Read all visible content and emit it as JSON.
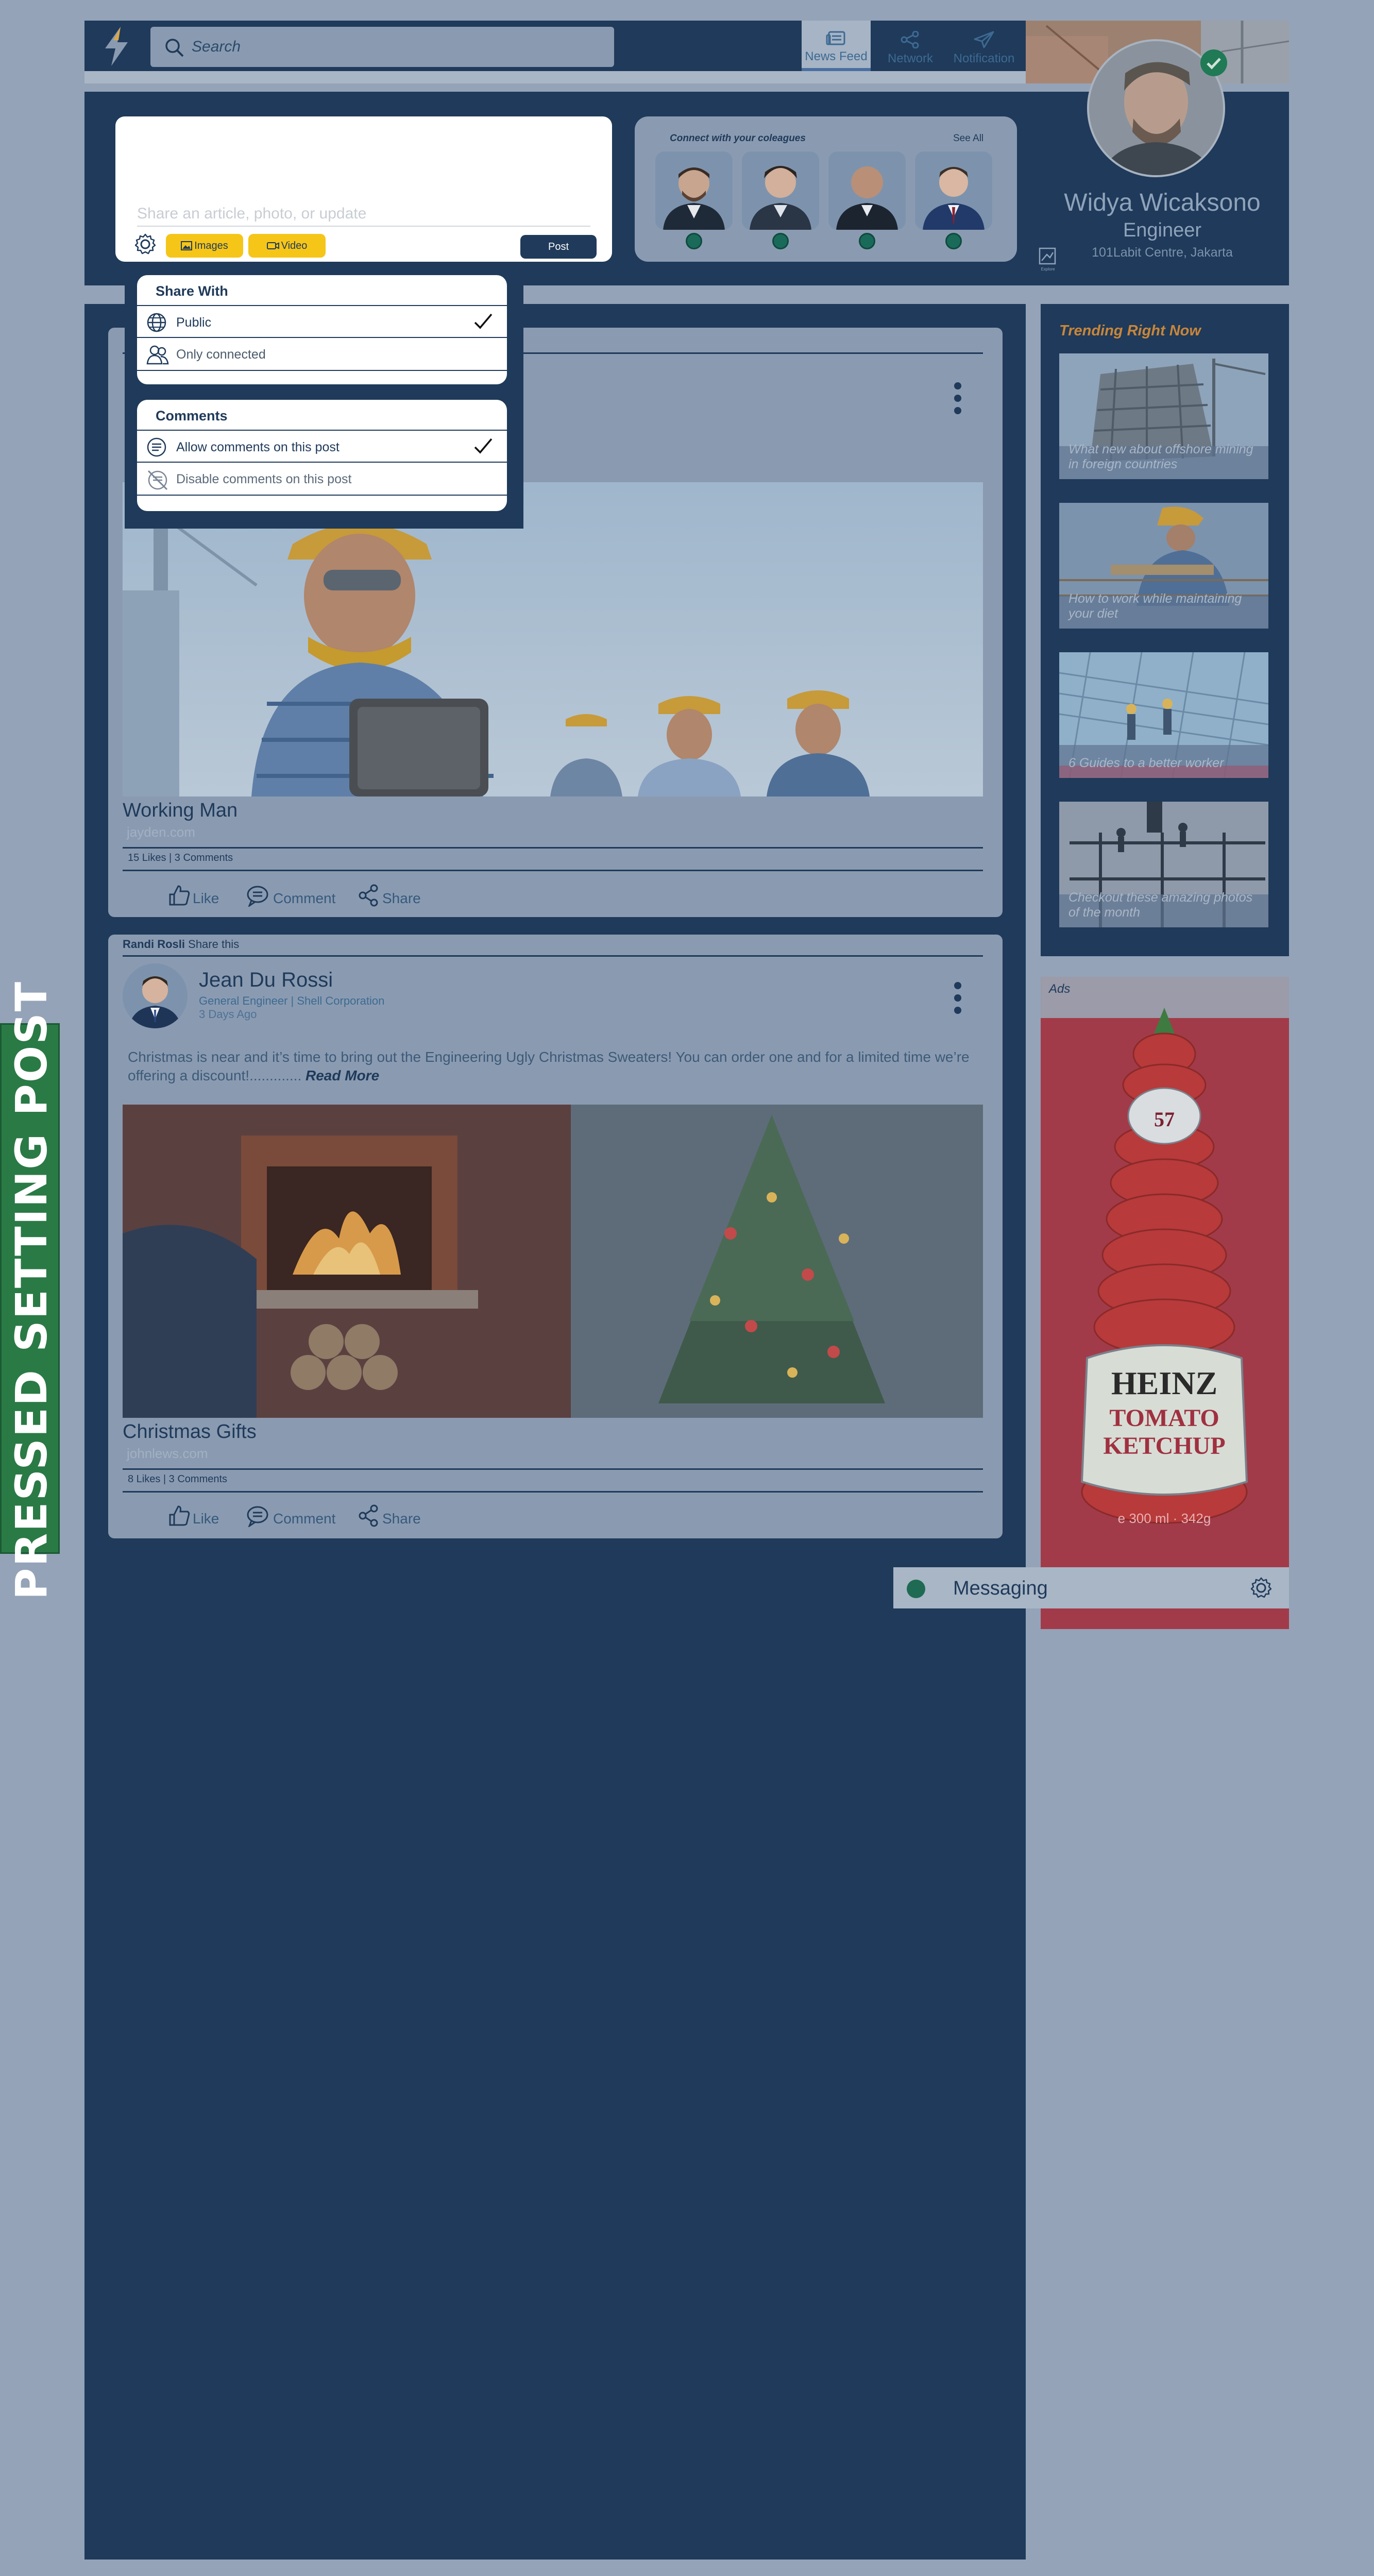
{
  "search": {
    "placeholder": "Search"
  },
  "nav": [
    {
      "label": "News Feed",
      "icon": "news-feed-icon",
      "active": true
    },
    {
      "label": "Network",
      "icon": "network-icon",
      "active": false
    },
    {
      "label": "Notification",
      "icon": "notification-icon",
      "active": false
    }
  ],
  "compose": {
    "placeholder": "Share an article, photo, or update",
    "images_label": "Images",
    "video_label": "Video",
    "post_label": "Post"
  },
  "connect": {
    "title": "Connect with your coleagues",
    "see_all": "See All"
  },
  "profile": {
    "name": "Widya Wicaksono",
    "role": "Engineer",
    "location": "101Labit Centre, Jakarta",
    "edit_label": "Explore"
  },
  "share_settings": {
    "share_with": {
      "title": "Share With",
      "options": [
        {
          "label": "Public",
          "icon": "globe-icon",
          "checked": true
        },
        {
          "label": "Only connected",
          "icon": "people-icon",
          "checked": false
        }
      ]
    },
    "comments": {
      "title": "Comments",
      "options": [
        {
          "label": "Allow comments on this post",
          "icon": "comment-icon",
          "checked": true
        },
        {
          "label": "Disable comments on this post",
          "icon": "comment-off-icon",
          "checked": false
        }
      ]
    }
  },
  "posts": [
    {
      "title": "Working Man",
      "source": "jayden.com",
      "stats": "15 Likes | 3 Comments",
      "actions": {
        "like": "Like",
        "comment": "Comment",
        "share": "Share"
      }
    },
    {
      "sharer": "Randi Rosli",
      "share_text": "Share this",
      "author": "Jean Du Rossi",
      "author_title": "General Engineer | Shell Corporation",
      "time": "3 Days Ago",
      "body": "Christmas is near and it’s time to bring out the Engineering Ugly Christmas Sweaters! You can order one and for a limited time we’re offering a discount!.............",
      "read_more": "Read More",
      "title": "Christmas Gifts",
      "source": "johnlews.com",
      "stats": "8 Likes | 3 Comments",
      "actions": {
        "like": "Like",
        "comment": "Comment",
        "share": "Share"
      }
    }
  ],
  "trending": {
    "title": "Trending Right Now",
    "items": [
      "What new about offshore mining in foreign countries",
      "How to work while maintaining your diet",
      "6 Guides to a better worker",
      "Checkout these amazing photos of the month"
    ]
  },
  "ads": {
    "label": "Ads",
    "bottle": {
      "brand": "HEINZ",
      "line1": "TOMATO",
      "line2": "KETCHUP",
      "number": "57",
      "volume": "e 300 ml · 342g"
    }
  },
  "messaging": {
    "label": "Messaging"
  },
  "side_tag": "PRESSED SETTING POST"
}
